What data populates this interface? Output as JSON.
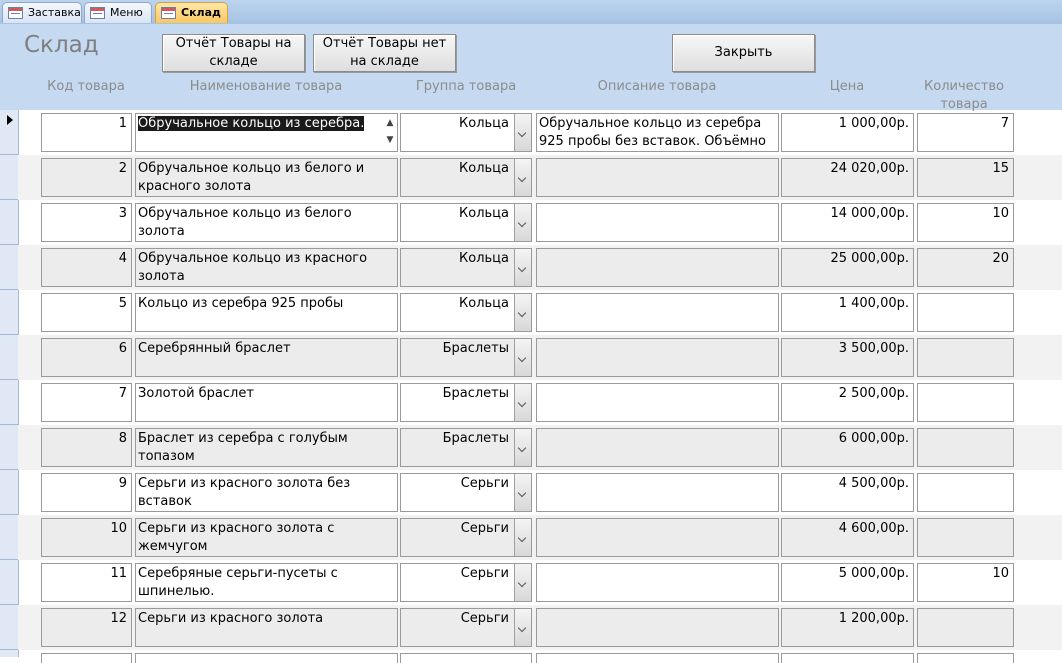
{
  "tabs": [
    {
      "label": "Заставка",
      "active": false,
      "icon": "form-icon"
    },
    {
      "label": "Меню",
      "active": false,
      "icon": "form-icon"
    },
    {
      "label": "Склад",
      "active": true,
      "icon": "form-icon"
    }
  ],
  "header": {
    "title": "Склад",
    "btn_in_stock": "Отчёт Товары на складе",
    "btn_not_in_stock": "Отчёт Товары нет на складе",
    "btn_close": "Закрыть"
  },
  "columns": {
    "code": "Код товара",
    "name": "Наименование товара",
    "group": "Группа товара",
    "description": "Описание товара",
    "price": "Цена",
    "quantity": "Количество товара"
  },
  "rows": [
    {
      "code": "1",
      "name": "Обручальное кольцо из серебра.",
      "group": "Кольца",
      "description": "Обручальное кольцо из серебра 925 пробы без вставок. Объёмно",
      "price": "1 000,00р.",
      "quantity": "7"
    },
    {
      "code": "2",
      "name": "Обручальное кольцо из белого и красного золота",
      "group": "Кольца",
      "description": "",
      "price": "24 020,00р.",
      "quantity": "15"
    },
    {
      "code": "3",
      "name": "Обручальное кольцо из белого золота",
      "group": "Кольца",
      "description": "",
      "price": "14 000,00р.",
      "quantity": "10"
    },
    {
      "code": "4",
      "name": "Обручальное кольцо из красного золота",
      "group": "Кольца",
      "description": "",
      "price": "25 000,00р.",
      "quantity": "20"
    },
    {
      "code": "5",
      "name": "Кольцо из серебра 925 пробы",
      "group": "Кольца",
      "description": "",
      "price": "1 400,00р.",
      "quantity": ""
    },
    {
      "code": "6",
      "name": "Серебрянный браслет",
      "group": "Браслеты",
      "description": "",
      "price": "3 500,00р.",
      "quantity": ""
    },
    {
      "code": "7",
      "name": "Золотой браслет",
      "group": "Браслеты",
      "description": "",
      "price": "2 500,00р.",
      "quantity": ""
    },
    {
      "code": "8",
      "name": "Браслет из серебра с голубым топазом",
      "group": "Браслеты",
      "description": "",
      "price": "6 000,00р.",
      "quantity": ""
    },
    {
      "code": "9",
      "name": "Серьги из красного золота без вставок",
      "group": "Серьги",
      "description": "",
      "price": "4 500,00р.",
      "quantity": ""
    },
    {
      "code": "10",
      "name": "Серьги из красного золота с жемчугом",
      "group": "Серьги",
      "description": "",
      "price": "4 600,00р.",
      "quantity": ""
    },
    {
      "code": "11",
      "name": "Серебряные серьги-пусеты с шпинелью.",
      "group": "Серьги",
      "description": "",
      "price": "5 000,00р.",
      "quantity": "10"
    },
    {
      "code": "12",
      "name": "Серьги из красного золота",
      "group": "Серьги",
      "description": "",
      "price": "1 200,00р.",
      "quantity": ""
    }
  ]
}
